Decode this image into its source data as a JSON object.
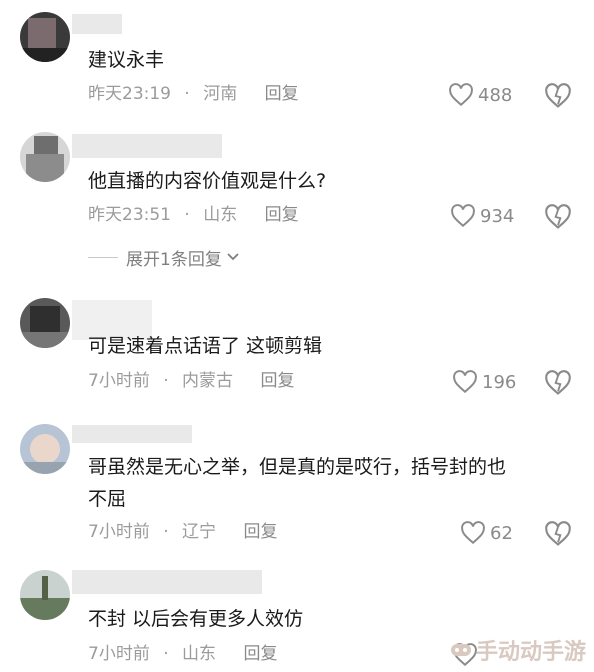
{
  "comments": [
    {
      "text": "建议永丰",
      "time": "昨天23:19",
      "location": "河南",
      "reply": "回复",
      "likes": "488"
    },
    {
      "text": "他直播的内容价值观是什么?",
      "time": "昨天23:51",
      "location": "山东",
      "reply": "回复",
      "likes": "934",
      "expand": "展开1条回复"
    },
    {
      "text": "可是速着点话语了 这顿剪辑",
      "time": "7小时前",
      "location": "内蒙古",
      "reply": "回复",
      "likes": "196"
    },
    {
      "text_line1": "哥虽然是无心之举，但是真的是哎行，括号封的也",
      "text_line2": "不屈",
      "time": "7小时前",
      "location": "辽宁",
      "reply": "回复",
      "likes": "62"
    },
    {
      "text": "不封 以后会有更多人效仿",
      "time": "7小时前",
      "location": "山东",
      "reply": "回复"
    }
  ],
  "separator": "·",
  "watermark": "手动动手游"
}
